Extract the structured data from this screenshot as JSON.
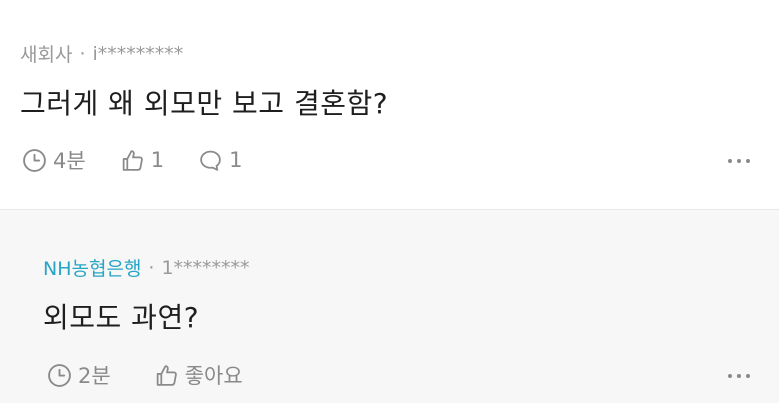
{
  "comment": {
    "author": "새회사",
    "separator": "·",
    "user_id": "i*********",
    "body": "그러게 왜 외모만 보고 결혼함?",
    "time": "4분",
    "likes": "1",
    "replies": "1"
  },
  "reply": {
    "author": "NH농협은행",
    "separator": "·",
    "user_id": "1********",
    "body": "외모도 과연?",
    "time": "2분",
    "like_label": "좋아요"
  },
  "icons": {
    "time": "clock-icon",
    "like": "thumbs-up-icon",
    "reply": "chat-bubble-icon",
    "more": "more-horizontal-icon"
  },
  "colors": {
    "reply_author": "#27a5c4",
    "reply_background": "#f7f7f7",
    "meta_text": "#9a9a9a"
  }
}
